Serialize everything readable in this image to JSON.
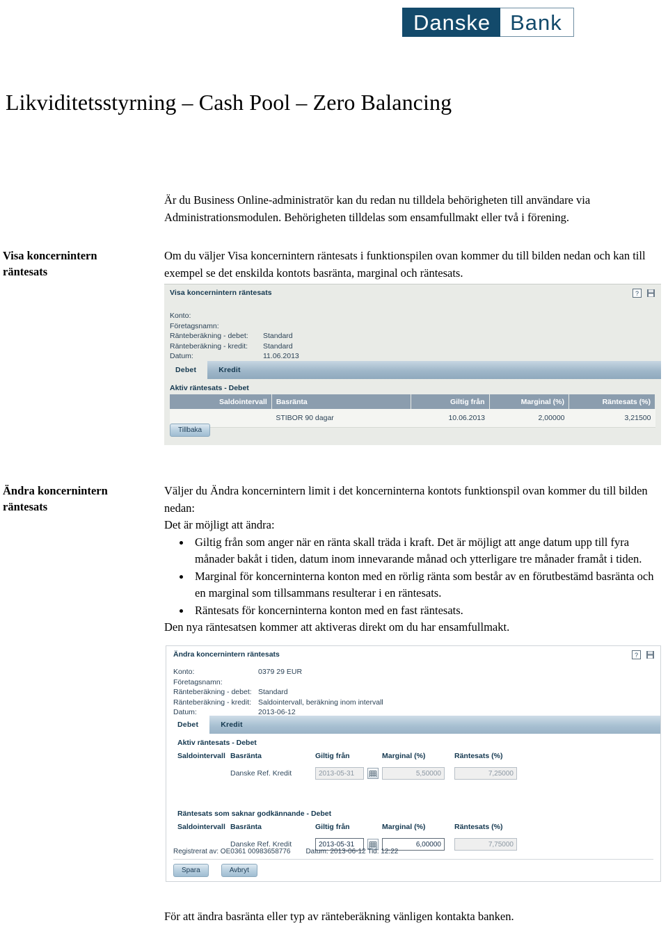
{
  "logo": {
    "part1": "Danske",
    "part2": "Bank"
  },
  "title": "Likviditetsstyrning – Cash Pool – Zero Balancing",
  "intro": "Är du Business Online-administratör kan du redan nu tilldela behörigheten till användare via Administrationsmodulen. Behörigheten tilldelas som ensamfullmakt eller två i förening.",
  "section1": {
    "margin_label_line1": "Visa koncernintern",
    "margin_label_line2": "räntesats",
    "paragraph": "Om du väljer Visa koncernintern räntesats i funktionspilen ovan kommer du till bilden nedan och kan till exempel se det enskilda kontots basränta, marginal och räntesats."
  },
  "screenshot1": {
    "title": "Visa koncernintern räntesats",
    "fields": [
      {
        "key": "Konto:",
        "value": ""
      },
      {
        "key": "Företagsnamn:",
        "value": ""
      },
      {
        "key": "Ränteberäkning - debet:",
        "value": "Standard"
      },
      {
        "key": "Ränteberäkning - kredit:",
        "value": "Standard"
      },
      {
        "key": "Datum:",
        "value": "11.06.2013"
      }
    ],
    "tabs": [
      {
        "label": "Debet",
        "active": true
      },
      {
        "label": "Kredit",
        "active": false
      }
    ],
    "section_label": "Aktiv räntesats - Debet",
    "columns": [
      "Saldointervall",
      "Basränta",
      "Giltig från",
      "Marginal (%)",
      "Räntesats (%)"
    ],
    "rows": [
      {
        "saldointervall": "",
        "basranta": "STIBOR 90 dagar",
        "giltig_fran": "10.06.2013",
        "marginal": "2,00000",
        "rantesats": "3,21500"
      }
    ],
    "back_button": "Tillbaka"
  },
  "section2": {
    "margin_label_line1": "Ändra koncernintern",
    "margin_label_line2": "räntesats",
    "para1": "Väljer du Ändra koncernintern limit i det koncerninterna kontots funktionspil ovan kommer du till bilden nedan:",
    "para2": "Det är möjligt att ändra:",
    "bullets": [
      "Giltig från som anger när en ränta skall träda i kraft. Det är möjligt att ange datum upp till fyra månader bakåt i tiden, datum inom innevarande månad och ytterligare tre månader framåt i tiden.",
      "Marginal för koncerninterna konton med en rörlig ränta som består av en förutbestämd basränta och en marginal som tillsammans resulterar i en räntesats.",
      "Räntesats för koncerninterna konton med en fast räntesats."
    ],
    "para3": "Den nya räntesatsen kommer att aktiveras direkt om du har ensamfullmakt."
  },
  "screenshot2": {
    "title": "Ändra koncernintern räntesats",
    "fields": [
      {
        "key": "Konto:",
        "value": "0379 29 EUR"
      },
      {
        "key": "Företagsnamn:",
        "value": ""
      },
      {
        "key": "Ränteberäkning - debet:",
        "value": "Standard"
      },
      {
        "key": "Ränteberäkning - kredit:",
        "value": "Saldointervall, beräkning inom intervall"
      },
      {
        "key": "Datum:",
        "value": "2013-06-12"
      }
    ],
    "tabs": [
      {
        "label": "Debet",
        "active": true
      },
      {
        "label": "Kredit",
        "active": false
      }
    ],
    "columns": [
      "Saldointervall",
      "Basränta",
      "Giltig från",
      "Marginal (%)",
      "Räntesats (%)"
    ],
    "table_a": {
      "label": "Aktiv räntesats - Debet",
      "row": {
        "saldointervall": "",
        "basranta": "Danske Ref. Kredit",
        "giltig_fran": "2013-05-31",
        "marginal": "5,50000",
        "rantesats": "7,25000"
      }
    },
    "table_b": {
      "label": "Räntesats som saknar godkännande - Debet",
      "row": {
        "saldointervall": "",
        "basranta": "Danske Ref. Kredit",
        "giltig_fran": "2013-05-31",
        "marginal": "6,00000",
        "rantesats": "7,75000"
      }
    },
    "registered_by": "Registrerat av: OE0361 00983658776",
    "registered_datetime": "Datum: 2013-06-12 Tid: 12:22",
    "save_button": "Spara",
    "cancel_button": "Avbryt"
  },
  "footer_note": "För att ändra basränta eller typ av ränteberäkning vänligen kontakta banken.",
  "colors": {
    "brand_blue": "#134a6b",
    "panel1_bg": "#e9ebe7",
    "table_header": "#8b9dae",
    "tab_bar": "#9fb7c9"
  }
}
